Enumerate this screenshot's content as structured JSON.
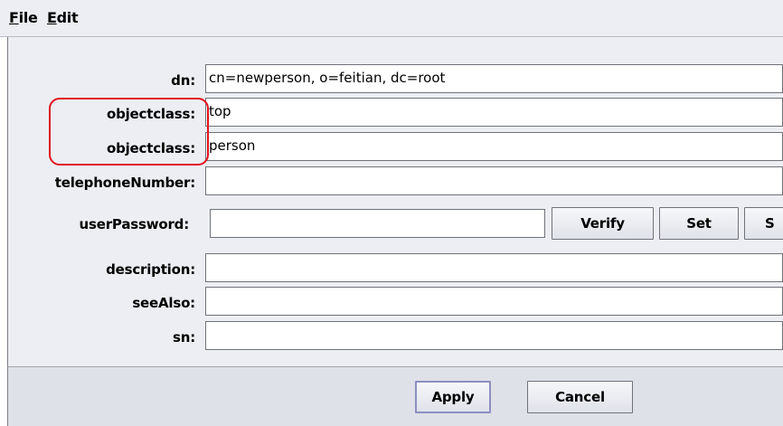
{
  "menu": {
    "file": "File",
    "file_mnemonic": "F",
    "file_rest": "ile",
    "edit_mnemonic": "E",
    "edit_rest": "dit"
  },
  "fields": {
    "dn": {
      "label": "dn:",
      "value": "cn=newperson, o=feitian, dc=root"
    },
    "objectclass_1": {
      "label": "objectclass:",
      "value": "top"
    },
    "objectclass_2": {
      "label": "objectclass:",
      "value": "person"
    },
    "telephoneNumber": {
      "label": "telephoneNumber:",
      "value": ""
    },
    "userPassword": {
      "label": "userPassword:",
      "value": ""
    },
    "description": {
      "label": "description:",
      "value": ""
    },
    "seeAlso": {
      "label": "seeAlso:",
      "value": ""
    },
    "sn": {
      "label": "sn:",
      "value": ""
    }
  },
  "password_buttons": {
    "verify": "Verify",
    "set": "Set",
    "third": "S"
  },
  "dialog_buttons": {
    "apply": "Apply",
    "cancel": "Cancel"
  },
  "colors": {
    "annotation": "#e0121d",
    "panel": "#eceef3"
  }
}
